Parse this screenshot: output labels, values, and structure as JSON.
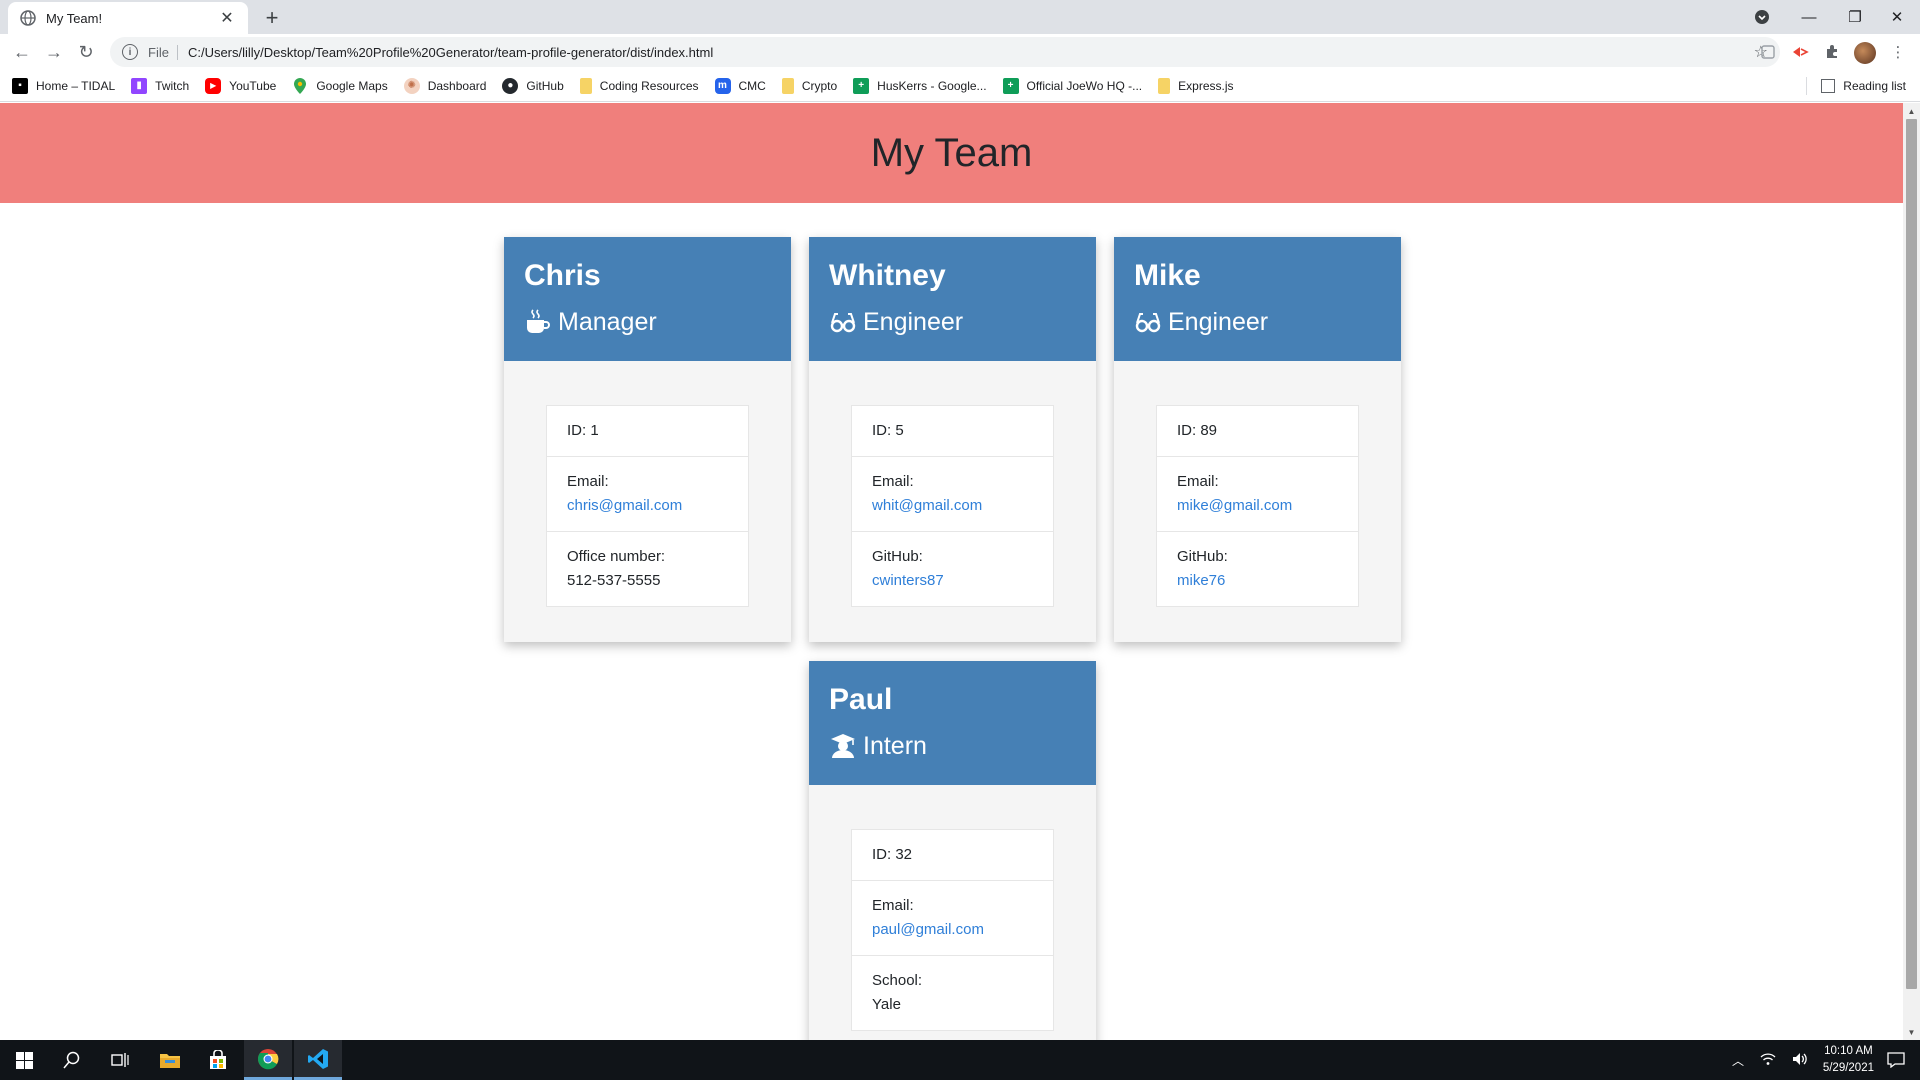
{
  "browser": {
    "tab_title": "My Team!",
    "new_tab": "+",
    "url_scheme": "File",
    "url": "C:/Users/lilly/Desktop/Team%20Profile%20Generator/team-profile-generator/dist/index.html",
    "bookmarks": [
      {
        "label": "Home – TIDAL",
        "icon": "tidal-icon",
        "color": "#000000"
      },
      {
        "label": "Twitch",
        "icon": "twitch-icon",
        "color": "#9146ff"
      },
      {
        "label": "YouTube",
        "icon": "youtube-icon",
        "color": "#ff0000"
      },
      {
        "label": "Google Maps",
        "icon": "google-maps-icon",
        "color": "#34a853"
      },
      {
        "label": "Dashboard",
        "icon": "dashboard-icon",
        "color": "#e8a07a"
      },
      {
        "label": "GitHub",
        "icon": "github-icon",
        "color": "#24292e"
      },
      {
        "label": "Coding Resources",
        "icon": "folder-icon",
        "color": "#f6c344"
      },
      {
        "label": "CMC",
        "icon": "cmc-icon",
        "color": "#2563eb"
      },
      {
        "label": "Crypto",
        "icon": "folder-icon",
        "color": "#f6c344"
      },
      {
        "label": "HusKerrs - Google...",
        "icon": "sheets-icon",
        "color": "#0f9d58"
      },
      {
        "label": "Official JoeWo HQ -...",
        "icon": "sheets-icon",
        "color": "#0f9d58"
      },
      {
        "label": "Express.js",
        "icon": "folder-icon",
        "color": "#f6c344"
      }
    ],
    "reading_list": "Reading list"
  },
  "page": {
    "title": "My Team",
    "header_color": "#f07f7c",
    "card_header_color": "#4680b5",
    "link_color": "#2f7fd8"
  },
  "team": [
    {
      "name": "Chris",
      "role": "Manager",
      "role_icon": "coffee-mug-icon",
      "id_text": "ID: 1",
      "email_label": "Email:",
      "email": "chris@gmail.com",
      "extra_label": "Office number:",
      "extra_value": "512-537-5555",
      "extra_is_link": false
    },
    {
      "name": "Whitney",
      "role": "Engineer",
      "role_icon": "glasses-icon",
      "id_text": "ID: 5",
      "email_label": "Email:",
      "email": "whit@gmail.com",
      "extra_label": "GitHub:",
      "extra_value": "cwinters87",
      "extra_is_link": true
    },
    {
      "name": "Mike",
      "role": "Engineer",
      "role_icon": "glasses-icon",
      "id_text": "ID: 89",
      "email_label": "Email:",
      "email": "mike@gmail.com",
      "extra_label": "GitHub:",
      "extra_value": "mike76",
      "extra_is_link": true
    },
    {
      "name": "Paul",
      "role": "Intern",
      "role_icon": "graduate-icon",
      "id_text": "ID: 32",
      "email_label": "Email:",
      "email": "paul@gmail.com",
      "extra_label": "School:",
      "extra_value": "Yale",
      "extra_is_link": false
    }
  ],
  "taskbar": {
    "time": "10:10 AM",
    "date": "5/29/2021"
  }
}
